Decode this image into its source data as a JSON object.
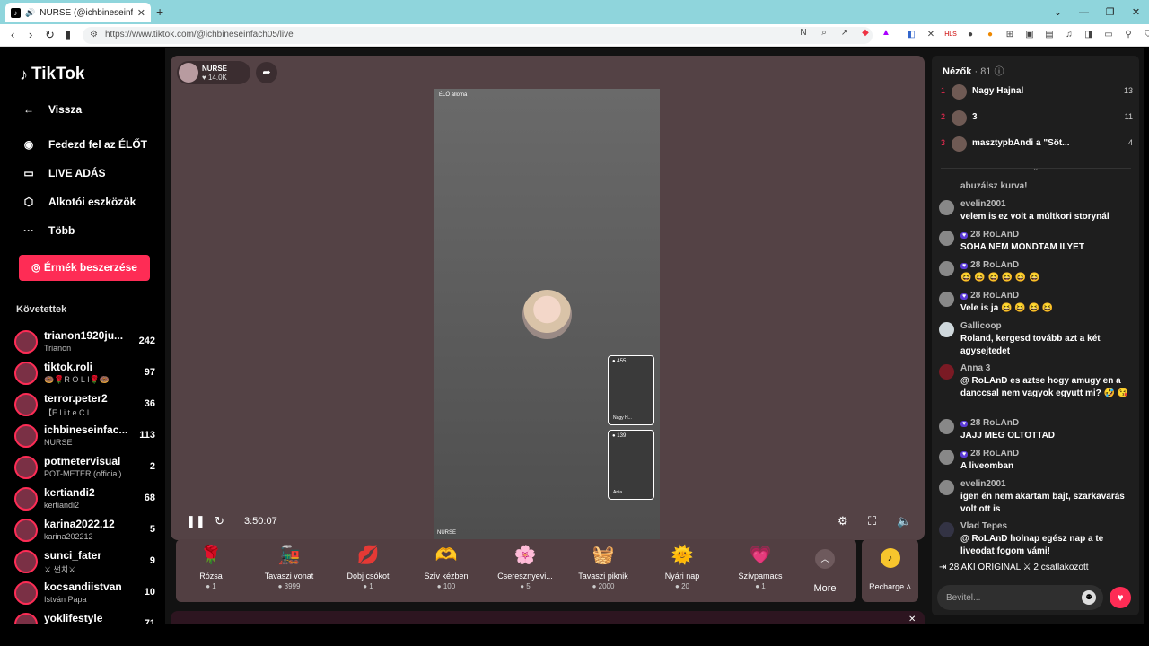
{
  "browser": {
    "tab_title": "NURSE (@ichbineseinfach05) |",
    "url": "https://www.tiktok.com/@ichbineseinfach05/live"
  },
  "sidebar": {
    "logo": "TikTok",
    "back": "Vissza",
    "nav": [
      "Fedezd fel az ÉLŐT",
      "LIVE ADÁS",
      "Alkotói eszközök",
      "Több"
    ],
    "coins_button": "Érmék beszerzése",
    "following_title": "Követettek",
    "following": [
      {
        "name": "trianon1920ju...",
        "sub": "Trianon",
        "count": "242"
      },
      {
        "name": "tiktok.roli",
        "sub": "🍩🌹R O L I🌹🍩",
        "count": "97"
      },
      {
        "name": "terror.peter2",
        "sub": "【E l i t e  C l...",
        "count": "36"
      },
      {
        "name": "ichbineseinfac...",
        "sub": "NURSE",
        "count": "113"
      },
      {
        "name": "potmetervisual",
        "sub": "POT-METER (official)",
        "count": "2"
      },
      {
        "name": "kertiandi2",
        "sub": "kertiandi2",
        "count": "68"
      },
      {
        "name": "karina2022.12",
        "sub": "karina202212",
        "count": "5"
      },
      {
        "name": "sunci_fater",
        "sub": "⚔ 썬치⚔",
        "count": "9"
      },
      {
        "name": "kocsandiistvan",
        "sub": "István Papa",
        "count": "10"
      },
      {
        "name": "yoklifestyle",
        "sub": "",
        "count": "71"
      }
    ]
  },
  "stream": {
    "host_name": "NURSE",
    "host_likes": "14.0K",
    "live_label": "ÉLŐ állomá",
    "video_name": "NURSE",
    "guest1_count": "455",
    "guest1_name": "Nagy H...",
    "guest2_count": "139",
    "guest2_name": "Ania",
    "elapsed": "3:50:07"
  },
  "gifts": [
    {
      "name": "Rózsa",
      "price": "1",
      "icon": "🌹"
    },
    {
      "name": "Tavaszi vonat",
      "price": "3999",
      "icon": "🚂"
    },
    {
      "name": "Dobj csókot",
      "price": "1",
      "icon": "💋"
    },
    {
      "name": "Szív kézben",
      "price": "100",
      "icon": "🫶"
    },
    {
      "name": "Cseresznyevi...",
      "price": "5",
      "icon": "🌸"
    },
    {
      "name": "Tavaszi piknik",
      "price": "2000",
      "icon": "🧺"
    },
    {
      "name": "Nyári nap",
      "price": "20",
      "icon": "🌞"
    },
    {
      "name": "Szívpamacs",
      "price": "1",
      "icon": "💗"
    }
  ],
  "more_label": "More",
  "recharge_label": "Recharge",
  "chat": {
    "viewers_label": "Nézők",
    "viewers_count": "· 81",
    "ranking": [
      {
        "rank": "1",
        "name": "Nagy Hajnal",
        "score": "13"
      },
      {
        "rank": "2",
        "name": "3",
        "score": "11"
      },
      {
        "rank": "3",
        "name": "masztурbAndi a \"Söt...",
        "score": "4"
      }
    ],
    "messages": [
      {
        "user": "",
        "text": "abuzálsz kurva!"
      },
      {
        "user": "evelin2001",
        "text": "velem is ez volt a múltkori storynál"
      },
      {
        "user": "28  RoLAnD",
        "text": "SOHA NEM MONDTAM ILYET"
      },
      {
        "user": "28  RoLAnD",
        "text": "😆 😆 😆 😆 😆 😆"
      },
      {
        "user": "28  RoLAnD",
        "text": "Vele is ja 😆 😆 😆 😆"
      },
      {
        "user": "Gallicoop",
        "text": "Roland, kergesd tovább azt a két agysejtedet"
      },
      {
        "user": "Anna  3",
        "text": "@ RoLAnD  es aztse hogy amugy en a danccsal nem vagyok egyutt mi? 🤣 😘"
      },
      {
        "user": "28  RoLAnD",
        "text": "JAJJ MEG OLTOTTAD"
      },
      {
        "user": "28  RoLAnD",
        "text": "A liveomban"
      },
      {
        "user": "evelin2001",
        "text": "igen én nem akartam bajt, szarkavarás volt ott is"
      },
      {
        "user": "Vlad Tepes",
        "text": "@ RoLAnD  holnap egész nap a te liveodat fogom vámi!"
      }
    ],
    "joined": "28 AKI ORIGINAL ⚔ 2  csatlakozott",
    "input_placeholder": "Bevitel..."
  }
}
